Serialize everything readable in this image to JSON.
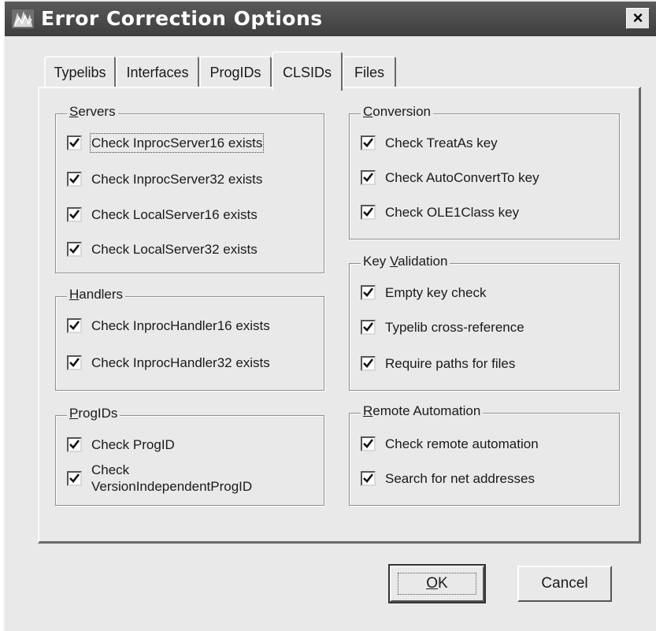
{
  "window": {
    "title": "Error Correction Options",
    "icon": "app-icon",
    "close_icon": "close-icon",
    "close_glyph": "×"
  },
  "tabs": [
    {
      "label": "Typelibs",
      "active": false
    },
    {
      "label": "Interfaces",
      "active": false
    },
    {
      "label": "ProgIDs",
      "active": false
    },
    {
      "label": "CLSIDs",
      "active": true
    },
    {
      "label": "Files",
      "active": false
    }
  ],
  "groups": {
    "servers": {
      "label_accel": "S",
      "label_rest": "ervers",
      "items": [
        {
          "label": "Check InprocServer16 exists",
          "checked": true
        },
        {
          "label": "Check InprocServer32 exists",
          "checked": true
        },
        {
          "label": "Check LocalServer16 exists",
          "checked": true
        },
        {
          "label": "Check LocalServer32 exists",
          "checked": true
        }
      ]
    },
    "handlers": {
      "label_accel": "H",
      "label_rest": "andlers",
      "items": [
        {
          "label": "Check InprocHandler16 exists",
          "checked": true
        },
        {
          "label": "Check InprocHandler32 exists",
          "checked": true
        }
      ]
    },
    "progids": {
      "label_accel": "P",
      "label_rest": "rogIDs",
      "items": [
        {
          "label": "Check ProgID",
          "checked": true
        },
        {
          "label": "Check VersionIndependentProgID",
          "checked": true
        }
      ]
    },
    "conversion": {
      "label_accel": "C",
      "label_rest": "onversion",
      "items": [
        {
          "label": "Check TreatAs key",
          "checked": true
        },
        {
          "label": "Check AutoConvertTo key",
          "checked": true
        },
        {
          "label": "Check OLE1Class key",
          "checked": true
        }
      ]
    },
    "key_validation": {
      "label_pre": "Key ",
      "label_accel": "V",
      "label_rest": "alidation",
      "items": [
        {
          "label": "Empty key check",
          "checked": true
        },
        {
          "label": "Typelib cross-reference",
          "checked": true
        },
        {
          "label": "Require paths for files",
          "checked": true
        }
      ]
    },
    "remote_automation": {
      "label_accel": "R",
      "label_rest": "emote Automation",
      "items": [
        {
          "label": "Check remote automation",
          "checked": true
        },
        {
          "label": "Search for net addresses",
          "checked": true
        }
      ]
    }
  },
  "buttons": {
    "ok_accel": "O",
    "ok_rest": "K",
    "cancel": "Cancel"
  }
}
